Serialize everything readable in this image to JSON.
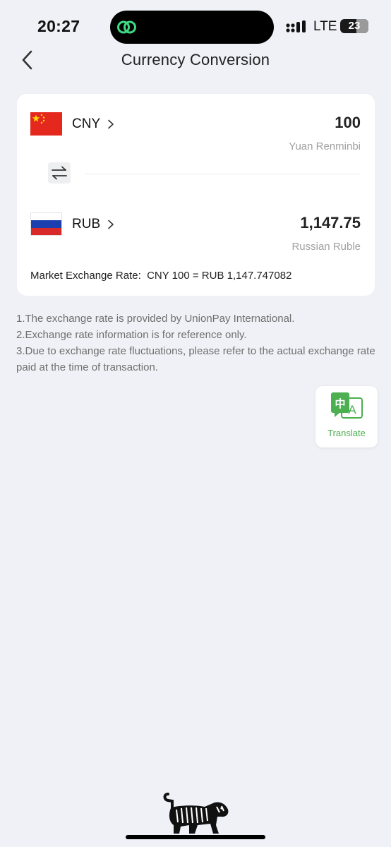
{
  "status_bar": {
    "time": "20:27",
    "network": "LTE",
    "battery_level": "23"
  },
  "header": {
    "title": "Currency Conversion",
    "back_icon": "chevron-left-icon"
  },
  "converter": {
    "from": {
      "code": "CNY",
      "amount": "100",
      "name": "Yuan Renminbi",
      "flag": "china-flag-icon"
    },
    "to": {
      "code": "RUB",
      "amount": "1,147.75",
      "name": "Russian Ruble",
      "flag": "russia-flag-icon"
    },
    "swap_icon": "swap-arrows-icon",
    "rate_label": "Market Exchange Rate:",
    "rate_value": "CNY 100 = RUB 1,147.747082"
  },
  "notes": [
    "1.The exchange rate is provided by UnionPay International.",
    "2.Exchange rate information is for reference only.",
    "3.Due to exchange rate fluctuations, please refer to the actual exchange rate paid at the time of transaction."
  ],
  "translate": {
    "label": "Translate",
    "icon": "translate-icon"
  },
  "colors": {
    "background": "#eff1f6",
    "card": "#ffffff",
    "accent_green": "#4caf50",
    "secondary_text": "#a0a0a0"
  }
}
